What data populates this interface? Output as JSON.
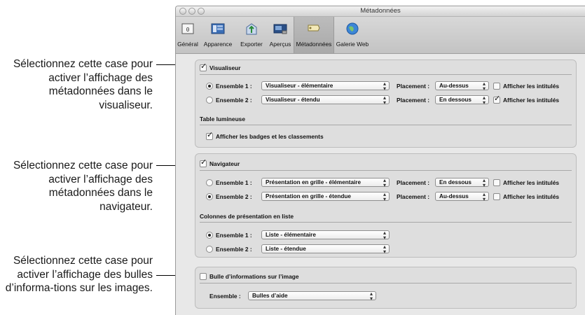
{
  "callouts": [
    "Sélectionnez cette case pour activer l’affichage des métadonnées dans le visualiseur.",
    "Sélectionnez cette case pour activer l’affichage des métadonnées dans le navigateur.",
    "Sélectionnez cette case pour activer l’affichage des bulles d’informa-tions sur les images."
  ],
  "window": {
    "title": "Métadonnées"
  },
  "toolbar": [
    {
      "label": "Général",
      "icon": "general-icon"
    },
    {
      "label": "Apparence",
      "icon": "appearance-icon"
    },
    {
      "label": "Exporter",
      "icon": "export-icon"
    },
    {
      "label": "Aperçus",
      "icon": "previews-icon"
    },
    {
      "label": "Métadonnées",
      "icon": "metadata-icon"
    },
    {
      "label": "Galerie Web",
      "icon": "web-gallery-icon"
    }
  ],
  "viewer": {
    "checkbox_label": "Visualiseur",
    "checked": true,
    "set1": {
      "label": "Ensemble 1 :",
      "value": "Visualiseur - élémentaire",
      "selected": true,
      "placement_label": "Placement :",
      "placement": "Au-dessus",
      "show_labels": "Afficher les intitulés",
      "show_labels_checked": false
    },
    "set2": {
      "label": "Ensemble 2 :",
      "value": "Visualiseur - étendu",
      "selected": false,
      "placement_label": "Placement :",
      "placement": "En dessous",
      "show_labels": "Afficher les intitulés",
      "show_labels_checked": true
    },
    "lighttable_heading": "Table lumineuse",
    "badges_label": "Afficher les badges et les classements",
    "badges_checked": true
  },
  "browser": {
    "checkbox_label": "Navigateur",
    "checked": true,
    "set1": {
      "label": "Ensemble 1 :",
      "value": "Présentation en grille - élémentaire",
      "selected": false,
      "placement_label": "Placement :",
      "placement": "En dessous",
      "show_labels": "Afficher les intitulés",
      "show_labels_checked": false
    },
    "set2": {
      "label": "Ensemble 2 :",
      "value": "Présentation en grille - étendue",
      "selected": true,
      "placement_label": "Placement :",
      "placement": "Au-dessus",
      "show_labels": "Afficher les intitulés",
      "show_labels_checked": false
    },
    "list_heading": "Colonnes de présentation en liste",
    "list1": {
      "label": "Ensemble 1 :",
      "value": "Liste - élémentaire",
      "selected": true
    },
    "list2": {
      "label": "Ensemble 2 :",
      "value": "Liste - étendue",
      "selected": false
    }
  },
  "tooltip": {
    "checkbox_label": "Bulle d’informations sur l’image",
    "checked": false,
    "set_label": "Ensemble :",
    "set_value": "Bulles d’aide"
  }
}
